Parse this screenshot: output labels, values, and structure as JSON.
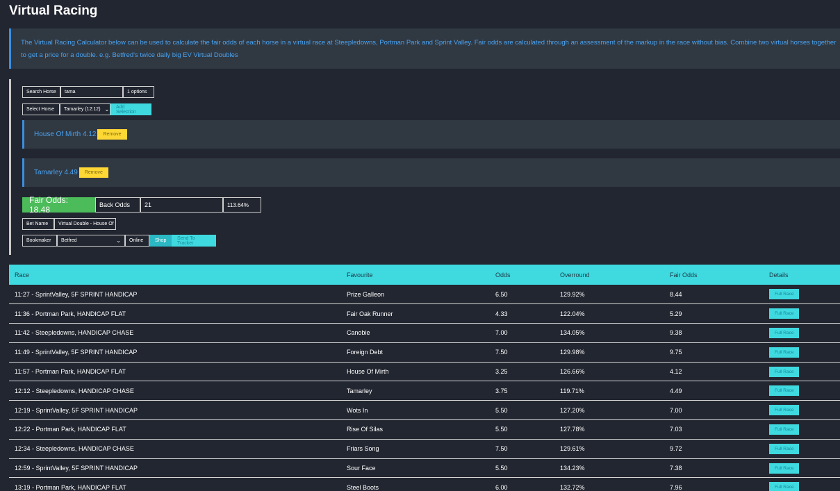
{
  "page_title": "Virtual Racing",
  "info_text": "The Virtual Racing Calculator below can be used to calculate the fair odds of each horse in a virtual race at Steepledowns, Portman Park and Sprint Valley. Fair odds are calculated through an assessment of the markup in the race without bias. Combine two virtual horses together to get a price for a double. e.g. Betfred's twice daily big EV Virtual Doubles",
  "search": {
    "label": "Search Horse",
    "value": "tama",
    "options_count": "1 options"
  },
  "select": {
    "label": "Select Horse",
    "value": "Tamarley (12:12)",
    "add_label": "Add Selection"
  },
  "selections": [
    {
      "name": "House Of Mirth 4.12",
      "remove_label": "Remove"
    },
    {
      "name": "Tamarley 4.49",
      "remove_label": "Remove"
    }
  ],
  "odds": {
    "fair_label": "Fair Odds: 18.48",
    "back_label": "Back Odds",
    "back_value": "21",
    "percent": "113.64%"
  },
  "bet_name": {
    "label": "Bet Name",
    "value": "Virtual Double - House Of"
  },
  "bookmaker": {
    "label": "Bookmaker",
    "value": "Betfred",
    "online_label": "Online",
    "shop_label": "Shop",
    "tracker_label": "Send To Tracker"
  },
  "colors": {
    "accent": "#3fd9e0",
    "fair_green": "#4cbb5a",
    "remove_yellow": "#fdd835",
    "link_blue": "#4aa3f0",
    "background": "#222630"
  },
  "table": {
    "headers": [
      "Race",
      "Favourite",
      "Odds",
      "Overround",
      "Fair Odds",
      "Details"
    ],
    "button_label": "Full Race",
    "rows": [
      [
        "11:27 - SprintValley, 5F SPRINT HANDICAP",
        "Prize Galleon",
        "6.50",
        "129.92%",
        "8.44"
      ],
      [
        "11:36 - Portman Park, HANDICAP FLAT",
        "Fair Oak Runner",
        "4.33",
        "122.04%",
        "5.29"
      ],
      [
        "11:42 - Steepledowns, HANDICAP CHASE",
        "Canobie",
        "7.00",
        "134.05%",
        "9.38"
      ],
      [
        "11:49 - SprintValley, 5F SPRINT HANDICAP",
        "Foreign Debt",
        "7.50",
        "129.98%",
        "9.75"
      ],
      [
        "11:57 - Portman Park, HANDICAP FLAT",
        "House Of Mirth",
        "3.25",
        "126.66%",
        "4.12"
      ],
      [
        "12:12 - Steepledowns, HANDICAP CHASE",
        "Tamarley",
        "3.75",
        "119.71%",
        "4.49"
      ],
      [
        "12:19 - SprintValley, 5F SPRINT HANDICAP",
        "Wots In",
        "5.50",
        "127.20%",
        "7.00"
      ],
      [
        "12:22 - Portman Park, HANDICAP FLAT",
        "Rise Of Silas",
        "5.50",
        "127.78%",
        "7.03"
      ],
      [
        "12:34 - Steepledowns, HANDICAP CHASE",
        "Friars Song",
        "7.50",
        "129.61%",
        "9.72"
      ],
      [
        "12:59 - SprintValley, 5F SPRINT HANDICAP",
        "Sour Face",
        "5.50",
        "134.23%",
        "7.38"
      ],
      [
        "13:19 - Portman Park, HANDICAP FLAT",
        "Steel Boots",
        "6.00",
        "132.72%",
        "7.96"
      ]
    ]
  }
}
